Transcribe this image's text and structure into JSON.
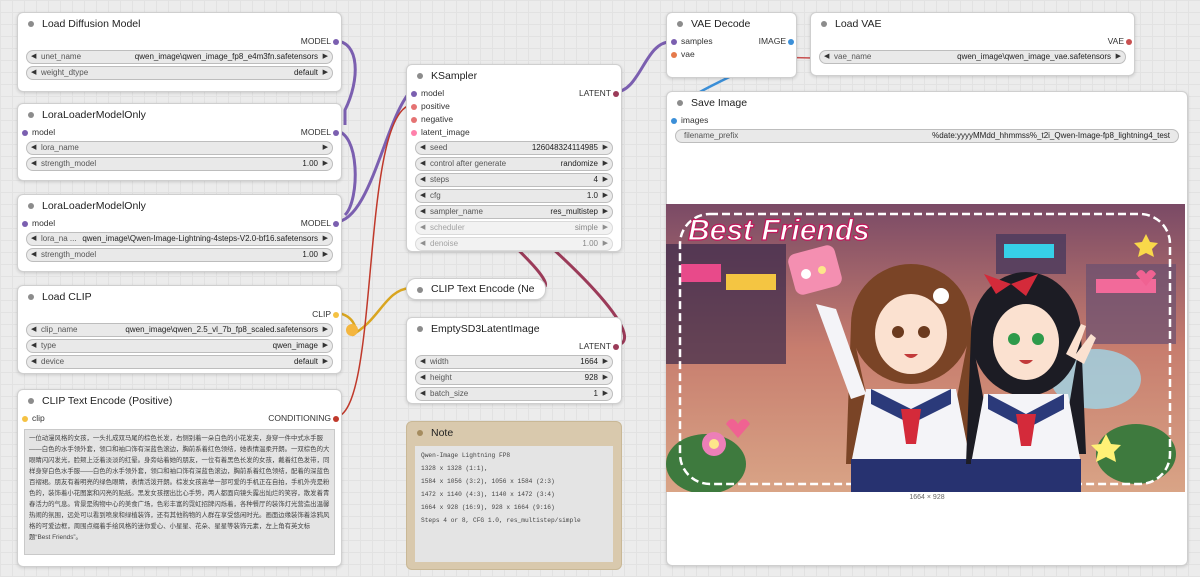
{
  "nodes": {
    "load_diffusion": {
      "title": "Load Diffusion Model",
      "out": "MODEL",
      "unet_label": "unet_name",
      "unet_value": "qwen_image\\qwen_image_fp8_e4m3fn.safetensors",
      "dtype_label": "weight_dtype",
      "dtype_value": "default"
    },
    "lora1": {
      "title": "LoraLoaderModelOnly",
      "in": "model",
      "out": "MODEL",
      "lora_label": "lora_name",
      "lora_value": "",
      "strength_label": "strength_model",
      "strength_value": "1.00"
    },
    "lora2": {
      "title": "LoraLoaderModelOnly",
      "in": "model",
      "out": "MODEL",
      "lora_label": "lora_na ...",
      "lora_value": "qwen_image\\Qwen-Image-Lightning-4steps-V2.0-bf16.safetensors",
      "strength_label": "strength_model",
      "strength_value": "1.00"
    },
    "load_clip": {
      "title": "Load CLIP",
      "out": "CLIP",
      "clip_label": "clip_name",
      "clip_value": "qwen_image\\qwen_2.5_vl_7b_fp8_scaled.safetensors",
      "type_label": "type",
      "type_value": "qwen_image",
      "device_label": "device",
      "device_value": "default"
    },
    "clip_pos": {
      "title": "CLIP Text Encode (Positive)",
      "in": "clip",
      "out": "CONDITIONING",
      "text": "一位动漫风格的女孩，一头扎成双马尾的棕色长发，右侧别着一朵白色的小花发夹，身穿一件中式水手服——白色的水手领外套，领口和袖口饰有深蓝色滚边，胸前系着红色领结，她表情温柔开朗。一双棕色的大眼睛闪闪发光，脸颊上泛着淡淡的红晕。身旁站着她的朋友，一位有着黑色长发的女孩，戴着红色发带，同样身穿白色水手服——白色的水手领外套，领口和袖口饰有深蓝色滚边，胸前系着红色领结，配着的深蓝色百褶裙。朋友有着明亮的绿色眼睛，表情活泼开朗。棕发女孩高举一部可爱的手机正在自拍，手机外壳是粉色的，装饰着小花图案和闪亮的贴纸。黑发女孩摆出比心手势，两人都面向镜头露出灿烂的笑容，散发着青春活力的气息。背景是购物中心的美食广场，色彩丰富的霓虹招牌闪烁着，各种餐厅的装饰灯光营造出温馨热闹的氛围，远处可以看到喷泉和绿植装饰，还有其他购物的人群在享受悠闲时光。画面边缘装饰着涂鸦风格的可爱边框，周围点缀着手绘风格的迷你爱心、小星星、花朵、星星等装饰元素，左上角有英文标题“Best Friends”。"
    },
    "ksampler": {
      "title": "KSampler",
      "inputs": [
        "model",
        "positive",
        "negative",
        "latent_image"
      ],
      "out": "LATENT",
      "widgets": [
        [
          "seed",
          "126048324114985"
        ],
        [
          "control after generate",
          "randomize"
        ],
        [
          "steps",
          "4"
        ],
        [
          "cfg",
          "1.0"
        ],
        [
          "sampler_name",
          "res_multistep"
        ],
        [
          "scheduler",
          "simple"
        ],
        [
          "denoise",
          "1.00"
        ]
      ]
    },
    "clip_neg": {
      "title": "CLIP Text Encode (Ne"
    },
    "empty_latent": {
      "title": "EmptySD3LatentImage",
      "out": "LATENT",
      "widgets": [
        [
          "width",
          "1664"
        ],
        [
          "height",
          "928"
        ],
        [
          "batch_size",
          "1"
        ]
      ]
    },
    "note": {
      "title": "Note",
      "lines": [
        "Qwen-Image Lightning FP8",
        "1328 x 1328 (1:1),",
        "1584 x 1056 (3:2),  1056 x 1584 (2:3)",
        "1472 x 1140 (4:3),  1140 x 1472 (3:4)",
        "1664 x  928 (16:9),  928 x 1664 (9:16)",
        "Steps 4 or 8, CFG 1.0, res_multistep/simple"
      ]
    },
    "vae_decode": {
      "title": "VAE Decode",
      "in1": "samples",
      "in2": "vae",
      "out": "IMAGE"
    },
    "load_vae": {
      "title": "Load VAE",
      "out": "VAE",
      "vae_label": "vae_name",
      "vae_value": "qwen_image\\qwen_image_vae.safetensors"
    },
    "save_image": {
      "title": "Save Image",
      "in": "images",
      "prefix_label": "filename_prefix",
      "prefix_value": "%date:yyyyMMdd_hhmmss%_t2i_Qwen-Image-fp8_lightning4_test",
      "caption": "1664 × 928",
      "image_title": "Best Friends"
    }
  },
  "colors": {
    "model": "#b39ddb",
    "clip": "#f5c243",
    "conditioning": "#e57373",
    "latent": "#ff80ab",
    "image": "#64b5f6",
    "vae": "#ff6e6e"
  }
}
